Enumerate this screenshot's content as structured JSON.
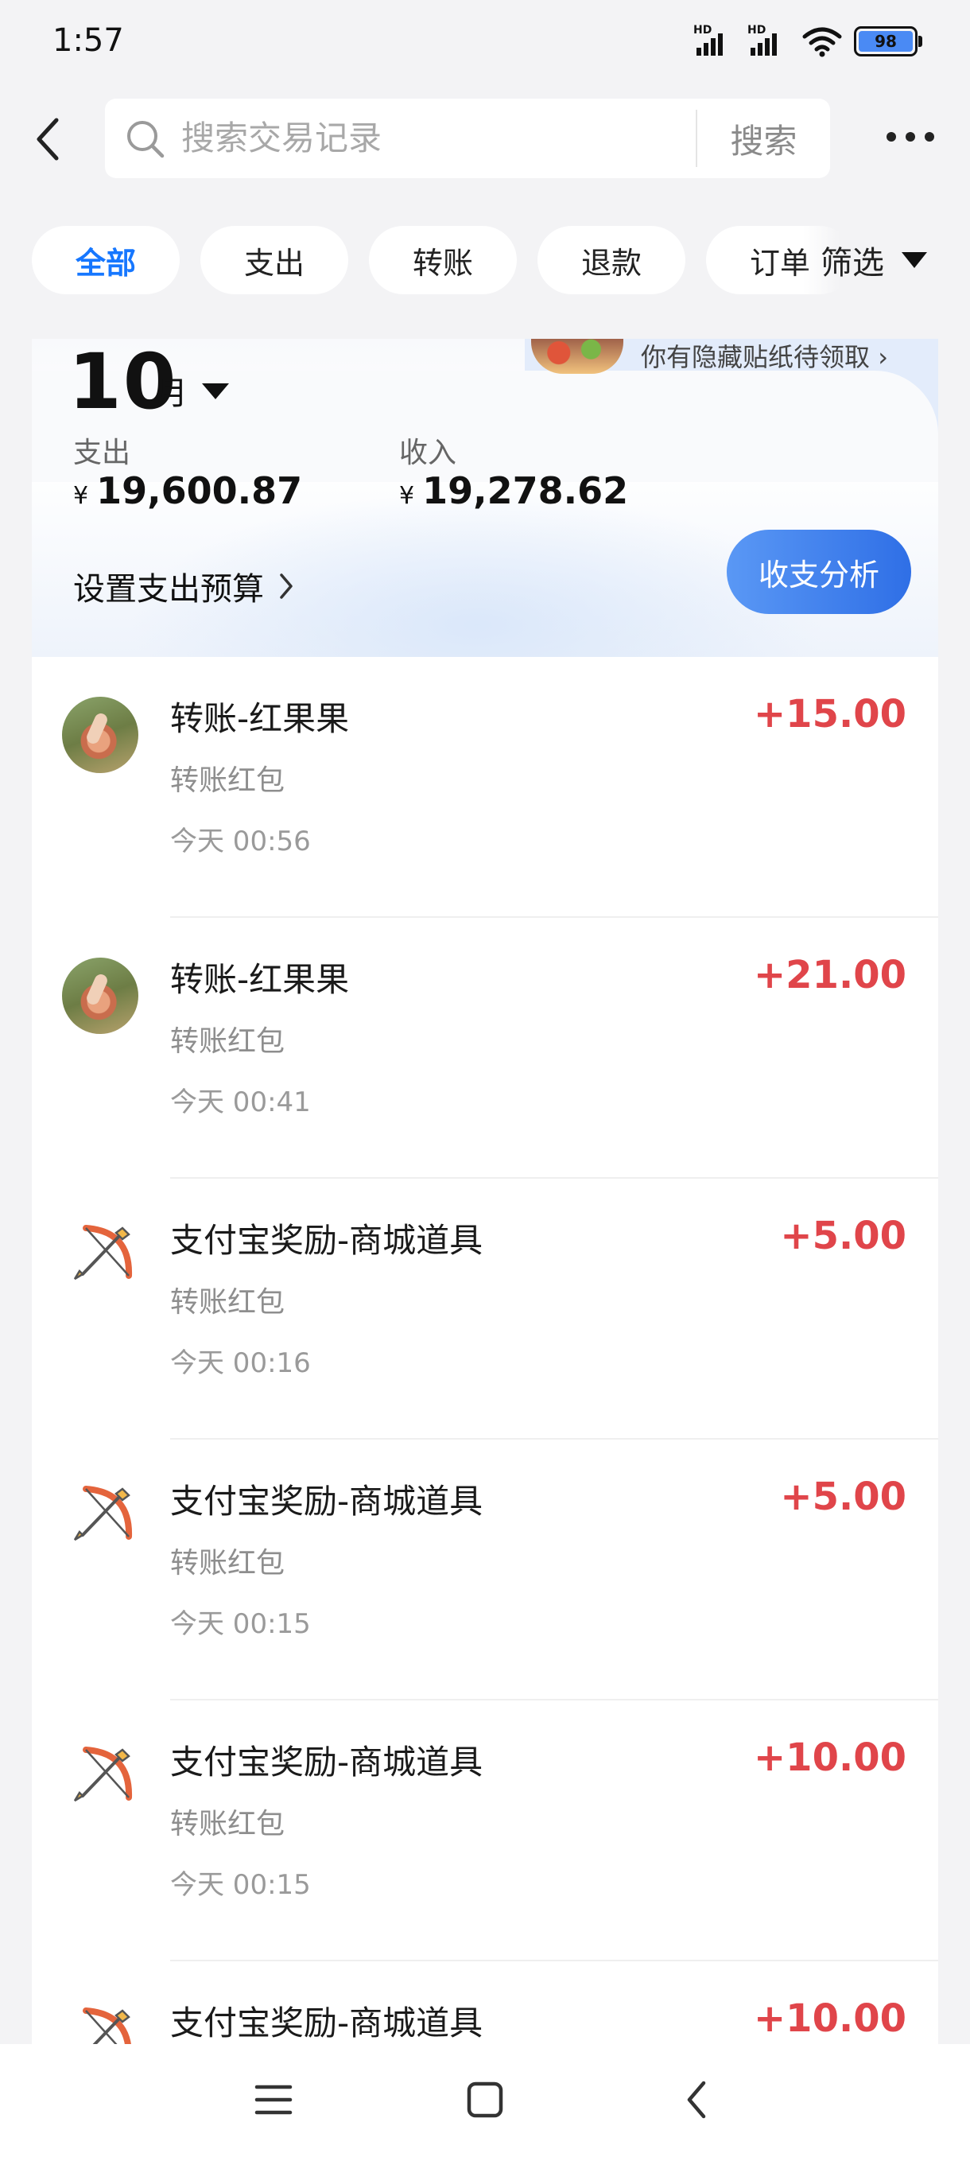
{
  "status_bar": {
    "time": "1:57",
    "network1": "HD",
    "network2": "HD",
    "sim2": "6",
    "battery": "98"
  },
  "search": {
    "placeholder": "搜索交易记录",
    "submit_label": "搜索"
  },
  "filters": {
    "chips": [
      "全部",
      "支出",
      "转账",
      "退款",
      "订单"
    ],
    "active_index": 0,
    "filter_label": "筛选"
  },
  "summary": {
    "sticker_text": "你有隐藏贴纸待领取",
    "month_number": "10",
    "month_unit": "月",
    "expense_label": "支出",
    "expense_value": "19,600.87",
    "income_label": "收入",
    "income_value": "19,278.62",
    "currency": "¥",
    "budget_label": "设置支出预算",
    "analysis_label": "收支分析"
  },
  "transactions": [
    {
      "title": "转账-红果果",
      "subtitle": "转账红包",
      "time": "今天 00:56",
      "amount": "+15.00",
      "icon": "user-avatar"
    },
    {
      "title": "转账-红果果",
      "subtitle": "转账红包",
      "time": "今天 00:41",
      "amount": "+21.00",
      "icon": "user-avatar"
    },
    {
      "title": "支付宝奖励-商城道具",
      "subtitle": "转账红包",
      "time": "今天 00:16",
      "amount": "+5.00",
      "icon": "bow-arrow-icon"
    },
    {
      "title": "支付宝奖励-商城道具",
      "subtitle": "转账红包",
      "time": "今天 00:15",
      "amount": "+5.00",
      "icon": "bow-arrow-icon"
    },
    {
      "title": "支付宝奖励-商城道具",
      "subtitle": "转账红包",
      "time": "今天 00:15",
      "amount": "+10.00",
      "icon": "bow-arrow-icon"
    },
    {
      "title": "支付宝奖励-商城道具",
      "subtitle": "",
      "time": "",
      "amount": "+10.00",
      "icon": "bow-arrow-icon"
    }
  ],
  "colors": {
    "accent": "#1677ff",
    "income": "#e0454a",
    "background": "#f3f3f5"
  },
  "nav": {
    "menu_icon": "menu-icon",
    "home_icon": "home-icon",
    "back_icon": "back-icon"
  }
}
